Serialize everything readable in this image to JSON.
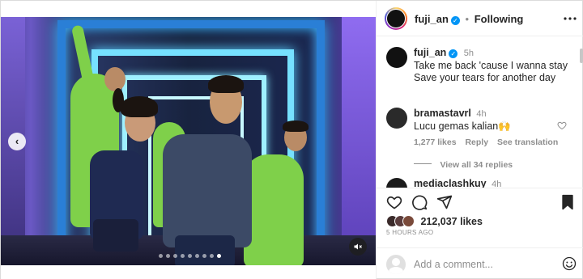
{
  "post": {
    "author": "fuji_an",
    "follow_state": "Following",
    "separator": "•",
    "verified_glyph": "✓",
    "carousel": {
      "slides_total": 9,
      "active_index": 8,
      "prev_glyph": "‹"
    }
  },
  "caption": {
    "author": "fuji_an",
    "time": "5h",
    "lines": [
      "Take me back 'cause I wanna stay",
      "Save your tears for another day"
    ]
  },
  "comments": [
    {
      "author": "bramastavrl",
      "time": "4h",
      "text": "Lucu gemas kalian🙌",
      "likes": "1,277 likes",
      "reply_label": "Reply",
      "translate_label": "See translation",
      "view_replies": "View all 34 replies"
    },
    {
      "author": "mediaclashkuy",
      "time": "4h"
    }
  ],
  "actions": {
    "likes_count": "212,037 likes",
    "time_ago": "5 HOURS AGO"
  },
  "composer": {
    "placeholder": "Add a comment..."
  },
  "colors": {
    "accent": "#0095f6",
    "text": "#262626",
    "muted": "#8e8e8e"
  },
  "icons": [
    "heart-icon",
    "comment-icon",
    "share-icon",
    "bookmark-icon",
    "more-icon",
    "emoji-icon",
    "mute-icon",
    "chevron-left-icon"
  ]
}
